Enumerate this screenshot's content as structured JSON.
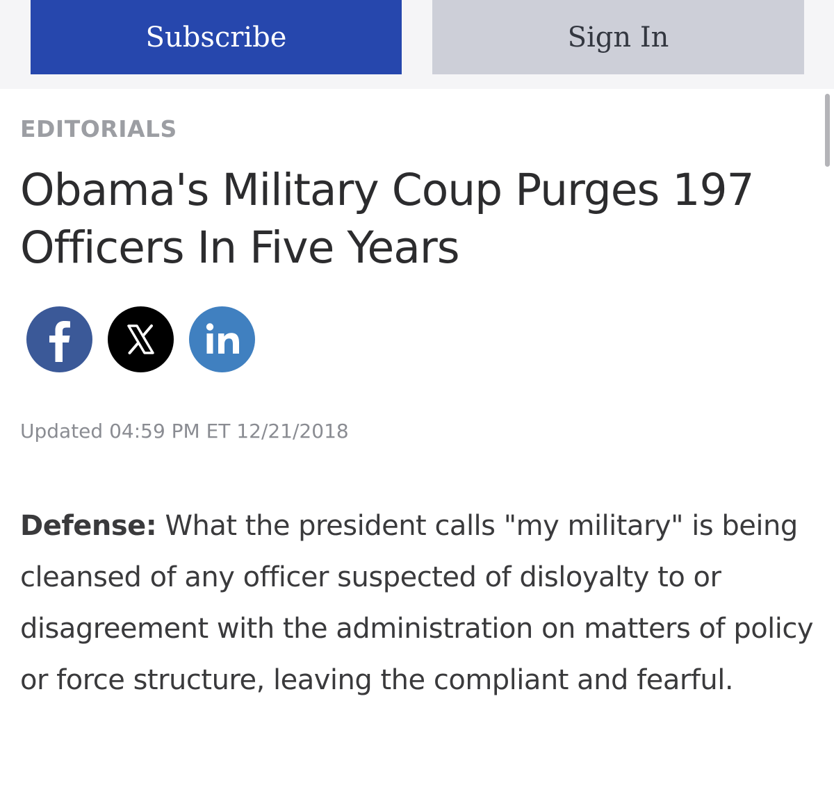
{
  "header": {
    "subscribe_label": "Subscribe",
    "signin_label": "Sign In",
    "subscribe_color": "#2647ad",
    "signin_color": "#cdcfd8"
  },
  "article": {
    "category": "EDITORIALS",
    "title": "Obama's Military Coup Purges 197 Officers In Five Years",
    "share": [
      {
        "icon": "facebook-icon",
        "color": "#3b5998"
      },
      {
        "icon": "x-icon",
        "color": "#000000"
      },
      {
        "icon": "linkedin-icon",
        "color": "#4080c0"
      }
    ],
    "updated": "Updated 04:59 PM ET 12/21/2018",
    "lede_label": "Defense:",
    "lede_text": " What the president calls \"my military\" is being cleansed of any officer suspected of disloyalty to or disagreement with the administration on matters of policy or force structure, leaving the compliant and fearful."
  }
}
